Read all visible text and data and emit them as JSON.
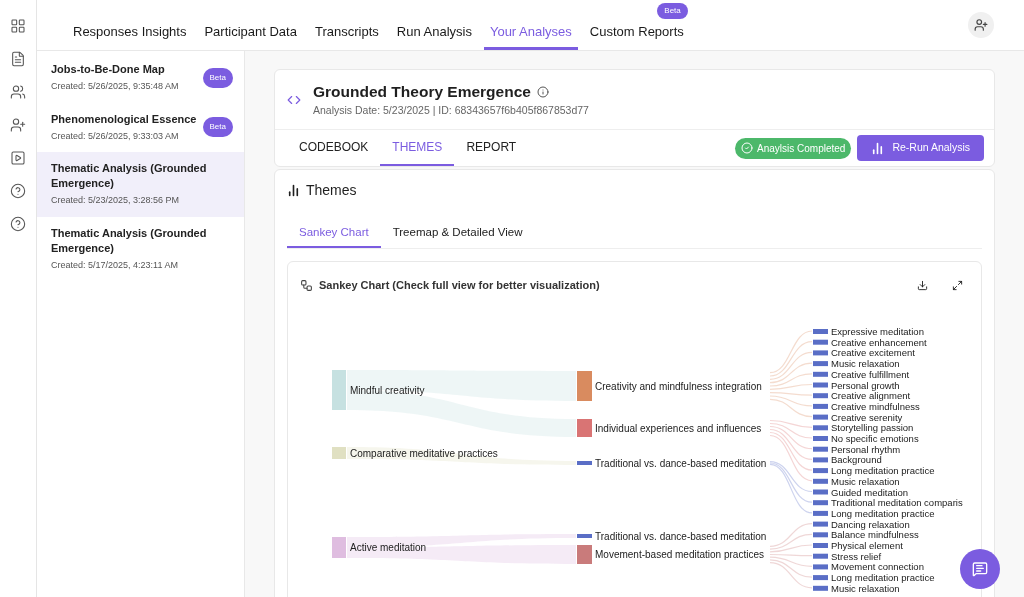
{
  "icon_rail": [
    {
      "kind": "grid"
    },
    {
      "kind": "document"
    },
    {
      "kind": "users"
    },
    {
      "kind": "user-plus"
    },
    {
      "kind": "media"
    },
    {
      "kind": "help"
    },
    {
      "kind": "help"
    }
  ],
  "nav_tabs": [
    {
      "label": "Responses Insights",
      "selected": false
    },
    {
      "label": "Participant Data",
      "selected": false
    },
    {
      "label": "Transcripts",
      "selected": false
    },
    {
      "label": "Run Analysis",
      "selected": false
    },
    {
      "label": "Your Analyses",
      "selected": true
    },
    {
      "label": "Custom Reports",
      "selected": false,
      "badge": "Beta"
    }
  ],
  "analyses": [
    {
      "title": "Jobs-to-Be-Done Map",
      "created": "Created: 5/26/2025, 9:35:48 AM",
      "badge": "Beta",
      "selected": false
    },
    {
      "title": "Phenomenological Essence",
      "created": "Created: 5/26/2025, 9:33:03 AM",
      "badge": "Beta",
      "selected": false
    },
    {
      "title": "Thematic Analysis (Grounded Emergence)",
      "created": "Created: 5/23/2025, 3:28:56 PM",
      "selected": true
    },
    {
      "title": "Thematic Analysis (Grounded Emergence)",
      "created": "Created: 5/17/2025, 4:23:11 AM",
      "selected": false
    }
  ],
  "analysis": {
    "title": "Grounded Theory Emergence",
    "meta": "Analysis Date: 5/23/2025 | ID: 68343657f6b405f867853d77",
    "tabs": [
      {
        "label": "CODEBOOK",
        "selected": false
      },
      {
        "label": "THEMES",
        "selected": true
      },
      {
        "label": "REPORT",
        "selected": false
      }
    ],
    "status": "Anaylsis Completed",
    "rerun_button": "Re-Run Analysis"
  },
  "themes": {
    "title": "Themes",
    "view_tabs": [
      {
        "label": "Sankey Chart",
        "selected": true
      },
      {
        "label": "Treemap & Detailed View",
        "selected": false
      }
    ],
    "sankey_title": "Sankey Chart (Check full view for better visualization)",
    "sankey": [
      {
        "label": "Mindful creativity",
        "color": "#c6e1e1",
        "children": [
          {
            "label": "Creativity and mindfulness integration",
            "color": "#d98b5f",
            "children": [
              {
                "label": "Expressive meditation"
              },
              {
                "label": "Creative enhancement"
              },
              {
                "label": "Creative excitement"
              },
              {
                "label": "Music relaxation"
              },
              {
                "label": "Creative fulfillment"
              },
              {
                "label": "Personal growth"
              },
              {
                "label": "Creative alignment"
              },
              {
                "label": "Creative mindfulness"
              },
              {
                "label": "Creative serenity"
              }
            ]
          },
          {
            "label": "Individual experiences and influences",
            "color": "#d97474",
            "children": [
              {
                "label": "Storytelling passion"
              },
              {
                "label": "No specific emotions"
              },
              {
                "label": "Personal rhythm"
              },
              {
                "label": "Background"
              },
              {
                "label": "Long meditation practice"
              },
              {
                "label": "Music relaxation"
              }
            ]
          }
        ]
      },
      {
        "label": "Comparative meditative practices",
        "color": "#e0e0c2",
        "children": [
          {
            "label": "Traditional vs. dance-based meditation",
            "color": "#5a6ec6",
            "children": [
              {
                "label": "Guided meditation"
              },
              {
                "label": "Traditional meditation comparis"
              },
              {
                "label": "Long meditation practice"
              }
            ]
          }
        ]
      },
      {
        "label": "Active meditation",
        "color": "#dfbde0",
        "children": [
          {
            "label": "Traditional vs. dance-based meditation",
            "color": "#5a6ec6"
          },
          {
            "label": "Movement-based meditation practices",
            "color": "#c97b7b",
            "children": [
              {
                "label": "Dancing relaxation"
              },
              {
                "label": "Balance mindfulness"
              },
              {
                "label": "Physical element"
              },
              {
                "label": "Stress relief"
              },
              {
                "label": "Movement connection"
              },
              {
                "label": "Long meditation practice"
              },
              {
                "label": "Music relaxation"
              }
            ]
          }
        ]
      }
    ]
  }
}
